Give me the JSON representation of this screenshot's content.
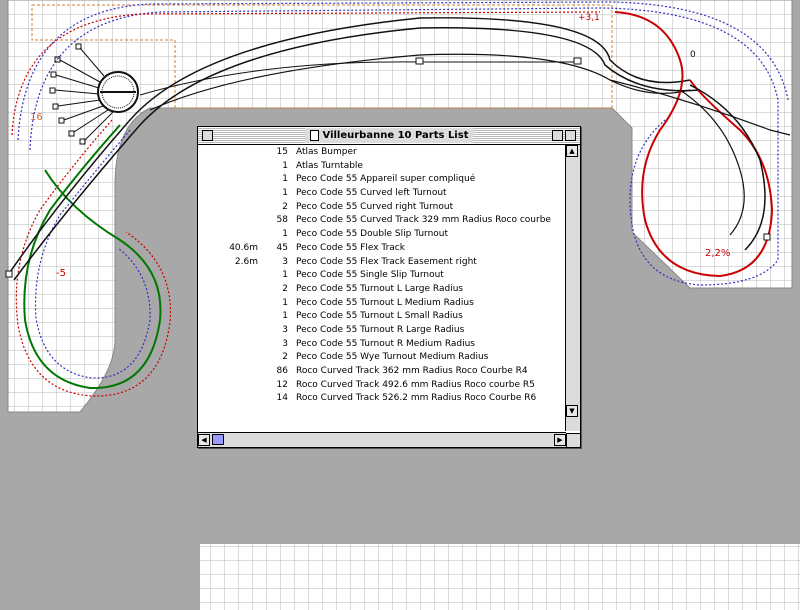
{
  "window": {
    "title": "Villeurbanne 10 Parts List"
  },
  "parts": [
    {
      "length": "",
      "qty": "15",
      "name": "Atlas Bumper"
    },
    {
      "length": "",
      "qty": "1",
      "name": "Atlas Turntable"
    },
    {
      "length": "",
      "qty": "1",
      "name": "Peco Code 55 Appareil super compliqué"
    },
    {
      "length": "",
      "qty": "1",
      "name": "Peco Code 55 Curved left Turnout"
    },
    {
      "length": "",
      "qty": "2",
      "name": "Peco Code 55 Curved right Turnout"
    },
    {
      "length": "",
      "qty": "58",
      "name": "Peco Code 55 Curved Track 329 mm Radius Roco courbe"
    },
    {
      "length": "",
      "qty": "1",
      "name": "Peco Code 55 Double Slip Turnout"
    },
    {
      "length": "40.6m",
      "qty": "45",
      "name": "Peco Code 55 Flex Track"
    },
    {
      "length": "2.6m",
      "qty": "3",
      "name": "Peco Code 55 Flex Track Easement right"
    },
    {
      "length": "",
      "qty": "1",
      "name": "Peco Code 55 Single Slip Turnout"
    },
    {
      "length": "",
      "qty": "2",
      "name": "Peco Code 55 Turnout L Large Radius"
    },
    {
      "length": "",
      "qty": "1",
      "name": "Peco Code 55 Turnout L Medium Radius"
    },
    {
      "length": "",
      "qty": "1",
      "name": "Peco Code 55 Turnout L Small Radius"
    },
    {
      "length": "",
      "qty": "3",
      "name": "Peco Code 55 Turnout R Large Radius"
    },
    {
      "length": "",
      "qty": "3",
      "name": "Peco Code 55 Turnout R Medium Radius"
    },
    {
      "length": "",
      "qty": "2",
      "name": "Peco Code 55 Wye Turnout Medium Radius"
    },
    {
      "length": "",
      "qty": "86",
      "name": "Roco Curved Track 362 mm Radius Roco Courbe R4"
    },
    {
      "length": "",
      "qty": "12",
      "name": "Roco Curved Track 492.6 mm Radius Roco courbe R5"
    },
    {
      "length": "",
      "qty": "14",
      "name": "Roco Curved Track 526.2 mm Radius Roco Courbe R6"
    }
  ],
  "layout_labels": {
    "grade_right": "2,2%",
    "grade_left": "-5",
    "label_16": "16",
    "label_top": "+3,1",
    "label_zero": "0"
  },
  "colors": {
    "grid_bg": "#ffffff",
    "grid_line": "#b8b8b8",
    "board_gray": "#a8a8a8",
    "track_red": "#cc0000",
    "track_green": "#007700",
    "dotted_blue": "#3030c0",
    "dotted_orange": "#d08030",
    "scroll_thumb": "#9999ff"
  }
}
